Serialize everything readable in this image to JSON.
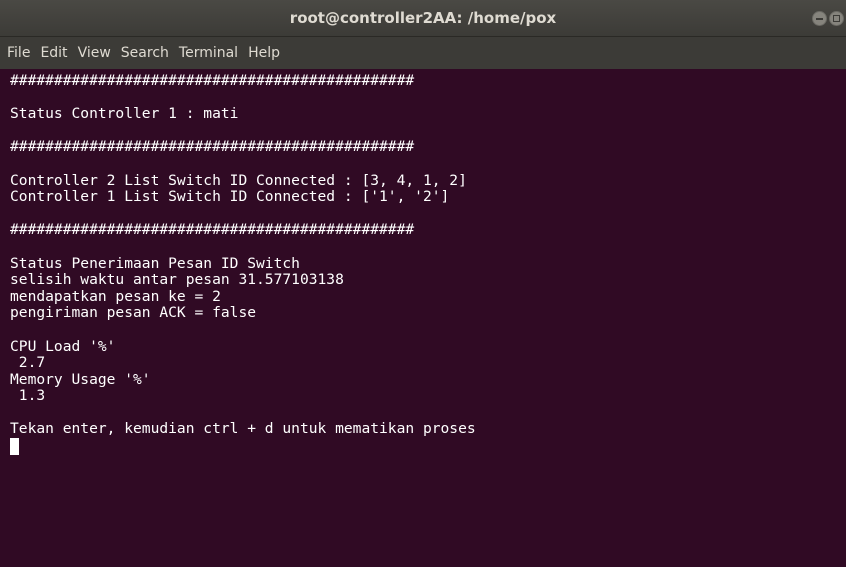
{
  "window": {
    "title": "root@controller2AA: /home/pox"
  },
  "menu": {
    "items": [
      "File",
      "Edit",
      "View",
      "Search",
      "Terminal",
      "Help"
    ]
  },
  "terminal": {
    "lines": [
      "##############################################",
      "",
      "Status Controller 1 : mati",
      "",
      "##############################################",
      "",
      "Controller 2 List Switch ID Connected : [3, 4, 1, 2]",
      "Controller 1 List Switch ID Connected : ['1', '2']",
      "",
      "##############################################",
      "",
      "Status Penerimaan Pesan ID Switch",
      "selisih waktu antar pesan 31.577103138",
      "mendapatkan pesan ke = 2",
      "pengiriman pesan ACK = false",
      "",
      "CPU Load '%'",
      " 2.7",
      "Memory Usage '%'",
      " 1.3",
      "",
      "Tekan enter, kemudian ctrl + d untuk mematikan proses"
    ]
  },
  "colors": {
    "terminal_background": "#300a24",
    "terminal_foreground": "#ffffff",
    "titlebar": "#3c3b37",
    "close_button": "#f0724a"
  }
}
